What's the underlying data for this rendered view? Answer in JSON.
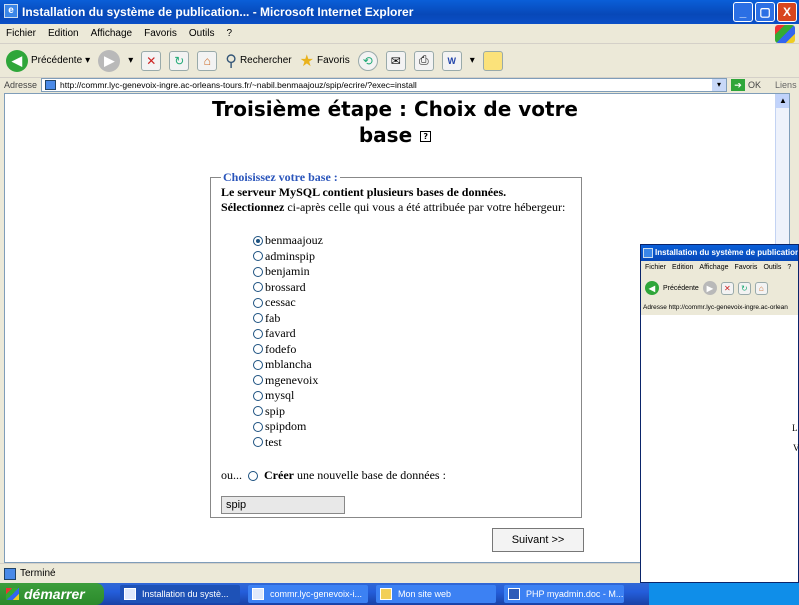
{
  "window": {
    "title": "Installation du système de publication... - Microsoft Internet Explorer",
    "minimize": "_",
    "maximize": "▢",
    "close": "X"
  },
  "menu": [
    "Fichier",
    "Edition",
    "Affichage",
    "Favoris",
    "Outils",
    "?"
  ],
  "toolbar": {
    "back_label": "Précédente",
    "search_label": "Rechercher",
    "favorites_label": "Favoris"
  },
  "address": {
    "label": "Adresse",
    "url": "http://commr.lyc-genevoix-ingre.ac-orleans-tours.fr/~nabil.benmaajouz/spip/ecrire/?exec=install",
    "go_label": "OK",
    "links_label": "Liens"
  },
  "page": {
    "title": "Troisième étape : Choix de votre base",
    "help": "?",
    "legend": "Choisissez votre base :",
    "intro_bold": "Le serveur MySQL contient plusieurs bases de données.",
    "select_bold": "Sélectionnez",
    "select_rest": " ci-après celle qui vous a été attribuée par votre hébergeur:",
    "databases": [
      "benmaajouz",
      "adminspip",
      "benjamin",
      "brossard",
      "cessac",
      "fab",
      "favard",
      "fodefo",
      "mblancha",
      "mgenevoix",
      "mysql",
      "spip",
      "spipdom",
      "test"
    ],
    "selected_database": "benmaajouz",
    "create_prefix": "ou...",
    "create_bold": "Créer",
    "create_rest": " une nouvelle base de données :",
    "new_db_value": "spip",
    "next_button": "Suivant >>"
  },
  "status": {
    "text": "Terminé"
  },
  "taskbar": {
    "start": "démarrer",
    "tasks": [
      "Installation du systè...",
      "commr.lyc-genevoix-i...",
      "Mon site web",
      "PHP myadmin.doc - M..."
    ]
  },
  "window2": {
    "title": "Installation du système de publication...",
    "menu": [
      "Fichier",
      "Edition",
      "Affichage",
      "Favoris",
      "Outils",
      "?"
    ],
    "back_label": "Précédente",
    "address_label": "Adresse",
    "url": "http://commr.lyc-genevoix-ingre.ac-orlean",
    "fragment1": "L",
    "fragment2": "V"
  }
}
